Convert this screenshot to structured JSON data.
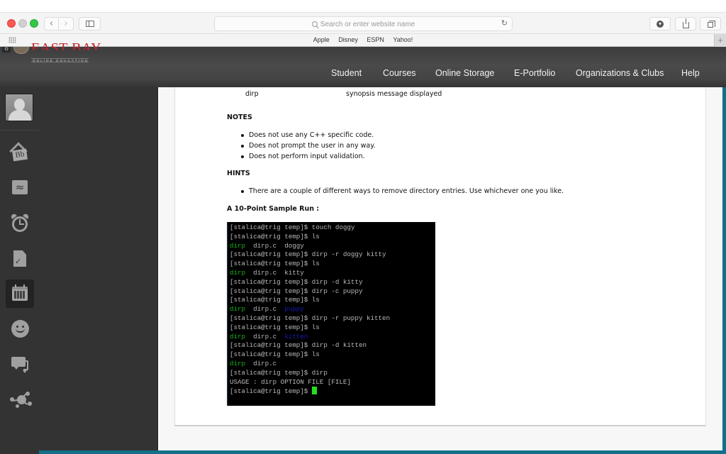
{
  "browser": {
    "url_placeholder": "Search or enter website name",
    "favorites": [
      "Apple",
      "Disney",
      "ESPN",
      "Yahoo!"
    ],
    "back_label": "‹",
    "forward_label": "›",
    "reload_label": "↻",
    "newtab_label": "+"
  },
  "site": {
    "logo_title": "EAST BAY",
    "logo_subtitle": "ONLINE EDUCATION",
    "nav": [
      "Student",
      "Courses",
      "Online Storage",
      "E-Portfolio",
      "Organizations & Clubs",
      "Help"
    ]
  },
  "sidebar": {
    "icons": [
      "avatar",
      "home-bb-icon",
      "grades-icon",
      "alarm-clock-icon",
      "assignment-check-icon",
      "calendar-icon",
      "smiley-icon",
      "chat-icon",
      "network-icon"
    ],
    "active": "calendar-icon",
    "home_icon_text": "Bb",
    "grades_icon_text": "≈",
    "check_icon_text": "✓"
  },
  "document": {
    "table_row": {
      "col1": "dirp",
      "col2": "synopsis message displayed"
    },
    "notes_heading": "NOTES",
    "notes": [
      "Does not use any C++ specific code.",
      "Does not prompt the user in any way.",
      "Does not perform input validation."
    ],
    "hints_heading": "HINTS",
    "hints": [
      "There are a couple of different ways to remove directory entries.  Use whichever one you like."
    ],
    "sample_heading": "A 10-Point Sample Run :"
  },
  "terminal": {
    "lines": [
      [
        {
          "t": "[stalica@trig temp]$ touch doggy",
          "c": "n"
        }
      ],
      [
        {
          "t": "[stalica@trig temp]$ ls",
          "c": "n"
        }
      ],
      [
        {
          "t": "dirp",
          "c": "g"
        },
        {
          "t": "  dirp.c  doggy",
          "c": "n"
        }
      ],
      [
        {
          "t": "[stalica@trig temp]$ dirp -r doggy kitty",
          "c": "n"
        }
      ],
      [
        {
          "t": "[stalica@trig temp]$ ls",
          "c": "n"
        }
      ],
      [
        {
          "t": "dirp",
          "c": "g"
        },
        {
          "t": "  dirp.c  kitty",
          "c": "n"
        }
      ],
      [
        {
          "t": "[stalica@trig temp]$ dirp -d kitty",
          "c": "n"
        }
      ],
      [
        {
          "t": "[stalica@trig temp]$ dirp -c puppy",
          "c": "n"
        }
      ],
      [
        {
          "t": "[stalica@trig temp]$ ls",
          "c": "n"
        }
      ],
      [
        {
          "t": "dirp",
          "c": "g"
        },
        {
          "t": "  dirp.c  ",
          "c": "n"
        },
        {
          "t": "puppy",
          "c": "b"
        }
      ],
      [
        {
          "t": "[stalica@trig temp]$ dirp -r puppy kitten",
          "c": "n"
        }
      ],
      [
        {
          "t": "[stalica@trig temp]$ ls",
          "c": "n"
        }
      ],
      [
        {
          "t": "dirp",
          "c": "g"
        },
        {
          "t": "  dirp.c  ",
          "c": "n"
        },
        {
          "t": "kitten",
          "c": "b"
        }
      ],
      [
        {
          "t": "[stalica@trig temp]$ dirp -d kitten",
          "c": "n"
        }
      ],
      [
        {
          "t": "[stalica@trig temp]$ ls",
          "c": "n"
        }
      ],
      [
        {
          "t": "dirp",
          "c": "g"
        },
        {
          "t": "  dirp.c",
          "c": "n"
        }
      ],
      [
        {
          "t": "[stalica@trig temp]$ dirp",
          "c": "n"
        }
      ],
      [
        {
          "t": "USAGE : dirp OPTION FILE [FILE]",
          "c": "n"
        }
      ],
      [
        {
          "t": "[stalica@trig temp]$ ",
          "c": "n"
        },
        {
          "t": "",
          "c": "cursor"
        }
      ]
    ]
  },
  "colors": {
    "accent_teal": "#12708a",
    "logo_red": "#c2252f",
    "term_green": "#16b416",
    "term_blue": "#1a1ab8",
    "cursor_green": "#22e022"
  }
}
